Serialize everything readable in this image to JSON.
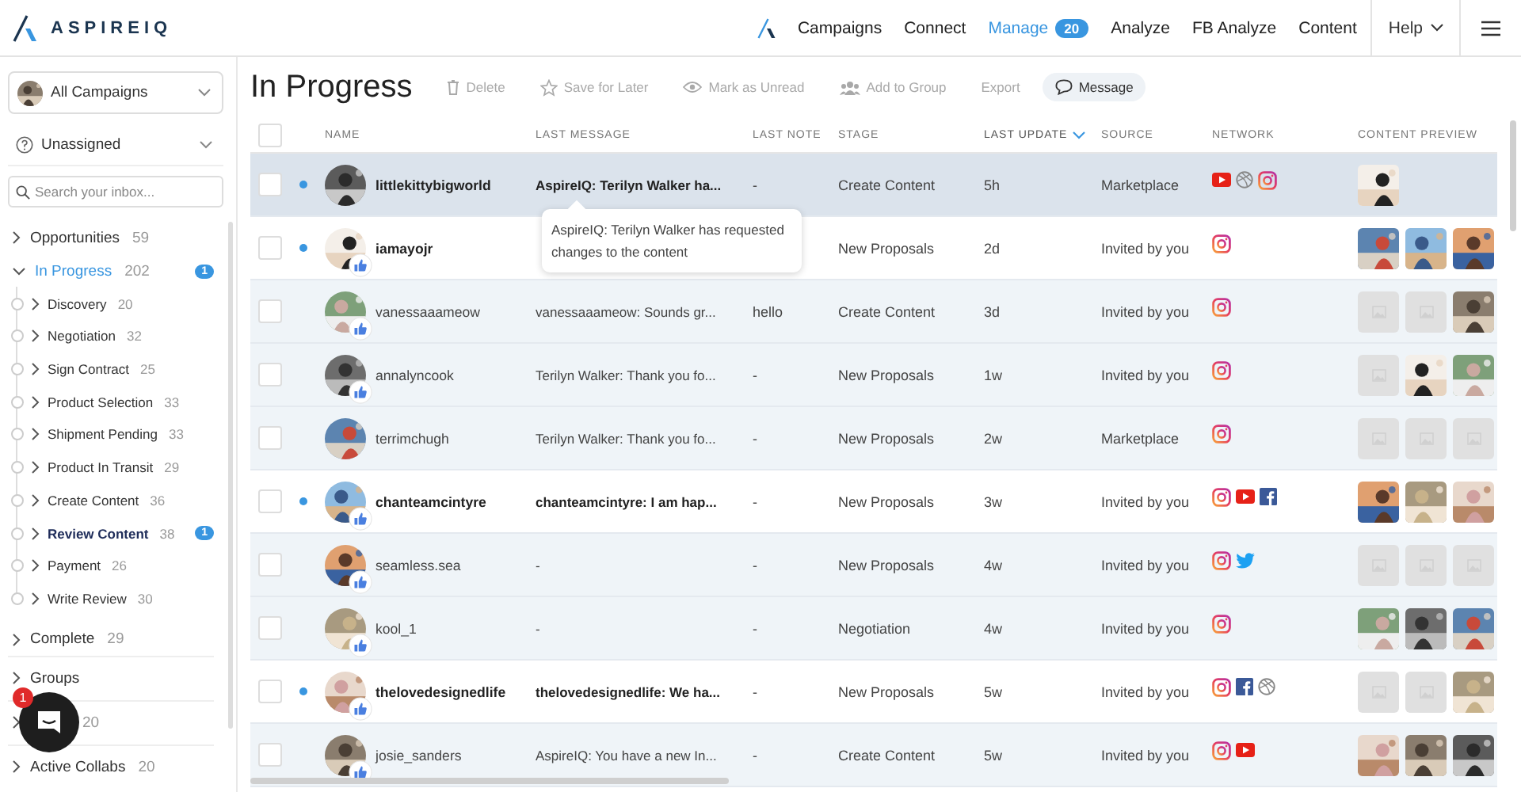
{
  "logo": {
    "text": "ASPIREIQ"
  },
  "nav": {
    "items": [
      {
        "label": "Campaigns",
        "selected": false
      },
      {
        "label": "Connect",
        "selected": false
      },
      {
        "label": "Manage",
        "selected": true,
        "badge": "20"
      },
      {
        "label": "Analyze",
        "selected": false
      },
      {
        "label": "FB Analyze",
        "selected": false
      },
      {
        "label": "Content",
        "selected": false
      }
    ],
    "help": "Help"
  },
  "sidebar": {
    "campaign": "All Campaigns",
    "assignee": "Unassigned",
    "search": {
      "placeholder": "Search your inbox..."
    },
    "items": [
      {
        "label": "Opportunities",
        "count": "59",
        "expanded": false,
        "selected": false
      },
      {
        "label": "In Progress",
        "count": "202",
        "expanded": true,
        "selected": true,
        "badge": "1",
        "children": [
          {
            "label": "Discovery",
            "count": "20",
            "selected": false
          },
          {
            "label": "Negotiation",
            "count": "32",
            "selected": false
          },
          {
            "label": "Sign Contract",
            "count": "25",
            "selected": false
          },
          {
            "label": "Product Selection",
            "count": "33",
            "selected": false
          },
          {
            "label": "Shipment Pending",
            "count": "33",
            "selected": false
          },
          {
            "label": "Product In Transit",
            "count": "29",
            "selected": false
          },
          {
            "label": "Create Content",
            "count": "36",
            "selected": false
          },
          {
            "label": "Review Content",
            "count": "38",
            "selected": true,
            "badge": "1"
          },
          {
            "label": "Payment",
            "count": "26",
            "selected": false
          },
          {
            "label": "Write Review",
            "count": "30",
            "selected": false
          }
        ]
      },
      {
        "label": "Complete",
        "count": "29",
        "expanded": false,
        "selected": false
      }
    ],
    "sections": [
      {
        "label": "Groups"
      },
      {
        "count": "20"
      },
      {
        "label": "Active Collabs",
        "count": "20"
      }
    ]
  },
  "chat": {
    "badge": "1"
  },
  "toolbar": {
    "title": "In Progress",
    "buttons": [
      {
        "label": "Delete",
        "disabled": true
      },
      {
        "label": "Save for Later",
        "disabled": true
      },
      {
        "label": "Mark as Unread",
        "disabled": true
      },
      {
        "label": "Add to Group",
        "disabled": true
      },
      {
        "label": "Export",
        "disabled": true
      },
      {
        "label": "Message",
        "disabled": false
      }
    ]
  },
  "table": {
    "header_checked": false,
    "columns": [
      {
        "label": "NAME",
        "sorted": false
      },
      {
        "label": "LAST MESSAGE",
        "sorted": false
      },
      {
        "label": "LAST NOTE",
        "sorted": false
      },
      {
        "label": "STAGE",
        "sorted": false
      },
      {
        "label": "LAST UPDATE",
        "sorted": true
      },
      {
        "label": "SOURCE",
        "sorted": false
      },
      {
        "label": "NETWORK",
        "sorted": false
      },
      {
        "label": "CONTENT PREVIEW",
        "sorted": false
      }
    ],
    "rows": [
      {
        "name": "littlekittybigworld",
        "unread": true,
        "highlighted": true,
        "checked": false,
        "liked": false,
        "last_message": "AspireIQ: Terilyn Walker ha...",
        "last_note": "-",
        "stage": "Create Content",
        "last_update": "5h",
        "source": "Marketplace",
        "networks": [
          {
            "kind": "youtube"
          },
          {
            "kind": "dribbble"
          },
          {
            "kind": "instagram"
          }
        ],
        "previews": [
          {
            "kind": "picture"
          }
        ]
      },
      {
        "name": "iamayojr",
        "unread": true,
        "highlighted": false,
        "checked": false,
        "liked": true,
        "stage": "New Proposals",
        "last_update": "2d",
        "source": "Invited by you",
        "networks": [
          {
            "kind": "instagram"
          }
        ],
        "previews": [
          {
            "kind": "picture"
          },
          {
            "kind": "picture"
          },
          {
            "kind": "picture"
          }
        ]
      },
      {
        "name": "vanessaaameow",
        "unread": false,
        "highlighted": false,
        "checked": false,
        "liked": true,
        "last_message": "vanessaaameow: Sounds gr...",
        "last_note": "hello",
        "stage": "Create Content",
        "last_update": "3d",
        "source": "Invited by you",
        "networks": [
          {
            "kind": "instagram"
          }
        ],
        "previews": [
          {
            "kind": "placeholder"
          },
          {
            "kind": "placeholder"
          },
          {
            "kind": "picture"
          }
        ]
      },
      {
        "name": "annalyncook",
        "unread": false,
        "highlighted": false,
        "checked": false,
        "liked": true,
        "last_message": "Terilyn Walker: Thank you fo...",
        "last_note": "-",
        "stage": "New Proposals",
        "last_update": "1w",
        "source": "Invited by you",
        "networks": [
          {
            "kind": "instagram"
          }
        ],
        "previews": [
          {
            "kind": "placeholder"
          },
          {
            "kind": "picture"
          },
          {
            "kind": "picture"
          }
        ]
      },
      {
        "name": "terrimchugh",
        "unread": false,
        "highlighted": false,
        "checked": false,
        "liked": false,
        "last_message": "Terilyn Walker: Thank you fo...",
        "last_note": "-",
        "stage": "New Proposals",
        "last_update": "2w",
        "source": "Marketplace",
        "networks": [
          {
            "kind": "instagram"
          }
        ],
        "previews": [
          {
            "kind": "placeholder"
          },
          {
            "kind": "placeholder"
          },
          {
            "kind": "placeholder"
          }
        ]
      },
      {
        "name": "chanteamcintyre",
        "unread": true,
        "highlighted": false,
        "checked": false,
        "liked": true,
        "last_message": "chanteamcintyre: I am hap...",
        "last_note": "-",
        "stage": "New Proposals",
        "last_update": "3w",
        "source": "Invited by you",
        "networks": [
          {
            "kind": "instagram"
          },
          {
            "kind": "youtube"
          },
          {
            "kind": "facebook"
          }
        ],
        "previews": [
          {
            "kind": "picture"
          },
          {
            "kind": "picture"
          },
          {
            "kind": "picture"
          }
        ]
      },
      {
        "name": "seamless.sea",
        "unread": false,
        "highlighted": false,
        "checked": false,
        "liked": true,
        "last_message": "-",
        "last_note": "-",
        "stage": "New Proposals",
        "last_update": "4w",
        "source": "Invited by you",
        "networks": [
          {
            "kind": "instagram"
          },
          {
            "kind": "twitter"
          }
        ],
        "previews": [
          {
            "kind": "placeholder"
          },
          {
            "kind": "placeholder"
          },
          {
            "kind": "placeholder"
          }
        ]
      },
      {
        "name": "kool_1",
        "unread": false,
        "highlighted": false,
        "checked": false,
        "liked": true,
        "last_message": "-",
        "last_note": "-",
        "stage": "Negotiation",
        "last_update": "4w",
        "source": "Invited by you",
        "networks": [
          {
            "kind": "instagram"
          }
        ],
        "previews": [
          {
            "kind": "picture"
          },
          {
            "kind": "picture"
          },
          {
            "kind": "picture"
          }
        ]
      },
      {
        "name": "thelovedesignedlife",
        "unread": true,
        "highlighted": false,
        "checked": false,
        "liked": true,
        "last_message": "thelovedesignedlife: We ha...",
        "last_note": "-",
        "stage": "New Proposals",
        "last_update": "5w",
        "source": "Invited by you",
        "networks": [
          {
            "kind": "instagram"
          },
          {
            "kind": "facebook"
          },
          {
            "kind": "dribbble"
          }
        ],
        "previews": [
          {
            "kind": "placeholder"
          },
          {
            "kind": "placeholder"
          },
          {
            "kind": "picture"
          }
        ]
      },
      {
        "name": "josie_sanders",
        "unread": false,
        "highlighted": false,
        "checked": false,
        "liked": true,
        "last_message": "AspireIQ: You have a new In...",
        "last_note": "-",
        "stage": "Create Content",
        "last_update": "5w",
        "source": "Invited by you",
        "networks": [
          {
            "kind": "instagram"
          },
          {
            "kind": "youtube"
          }
        ],
        "previews": [
          {
            "kind": "picture"
          },
          {
            "kind": "picture"
          },
          {
            "kind": "picture"
          }
        ]
      }
    ],
    "tooltip": {
      "text": "AspireIQ: Terilyn Walker has requested changes to the content"
    }
  }
}
